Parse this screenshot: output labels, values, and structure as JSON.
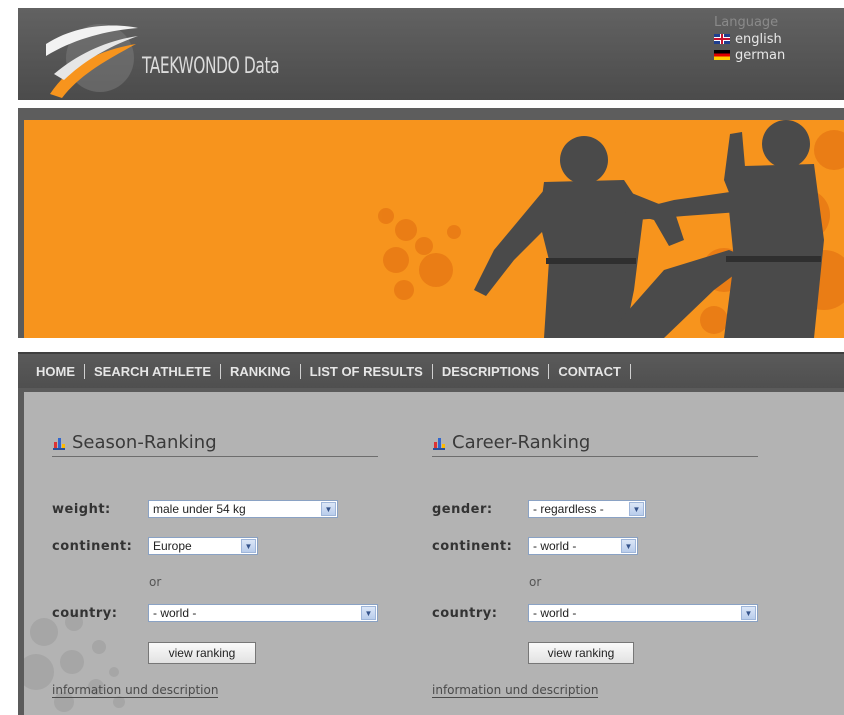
{
  "header": {
    "logo_text": "TAEKWONDO Data",
    "language": {
      "title": "Language",
      "options": [
        {
          "label": "english",
          "flag": "uk-flag-icon"
        },
        {
          "label": "german",
          "flag": "german-flag-icon"
        }
      ]
    }
  },
  "nav": {
    "items": [
      "HOME",
      "SEARCH ATHLETE",
      "RANKING",
      "LIST OF RESULTS",
      "DESCRIPTIONS",
      "CONTACT"
    ]
  },
  "season": {
    "title": "Season-Ranking",
    "weight_label": "weight:",
    "weight_value": "male under 54 kg",
    "continent_label": "continent:",
    "continent_value": "Europe",
    "or": "or",
    "country_label": "country:",
    "country_value": "- world -",
    "button": "view ranking",
    "info": "information und description"
  },
  "career": {
    "title": "Career-Ranking",
    "gender_label": "gender:",
    "gender_value": "- regardless -",
    "continent_label": "continent:",
    "continent_value": "- world -",
    "or": "or",
    "country_label": "country:",
    "country_value": "- world -",
    "button": "view ranking",
    "info": "information und description"
  },
  "colors": {
    "banner_orange": "#f7941d",
    "header_gray": "#555555",
    "content_gray": "#b3b3b3"
  }
}
